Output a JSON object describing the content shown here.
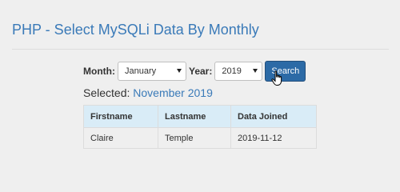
{
  "page": {
    "title": "PHP - Select MySQLi Data By Monthly"
  },
  "filters": {
    "month_label": "Month:",
    "month_value": "January",
    "year_label": "Year:",
    "year_value": "2019",
    "search_label": "Search"
  },
  "selected": {
    "label": "Selected:",
    "value": "November 2019"
  },
  "table": {
    "headers": [
      "Firstname",
      "Lastname",
      "Data Joined"
    ],
    "rows": [
      [
        "Claire",
        "Temple",
        "2019-11-12"
      ]
    ]
  },
  "icons": {
    "cursor": "hand-pointer-icon",
    "dropdown": "chevron-down-icon"
  },
  "colors": {
    "title": "#3a7ab8",
    "button": "#2c6aa6",
    "table_header": "#d9ecf7"
  }
}
